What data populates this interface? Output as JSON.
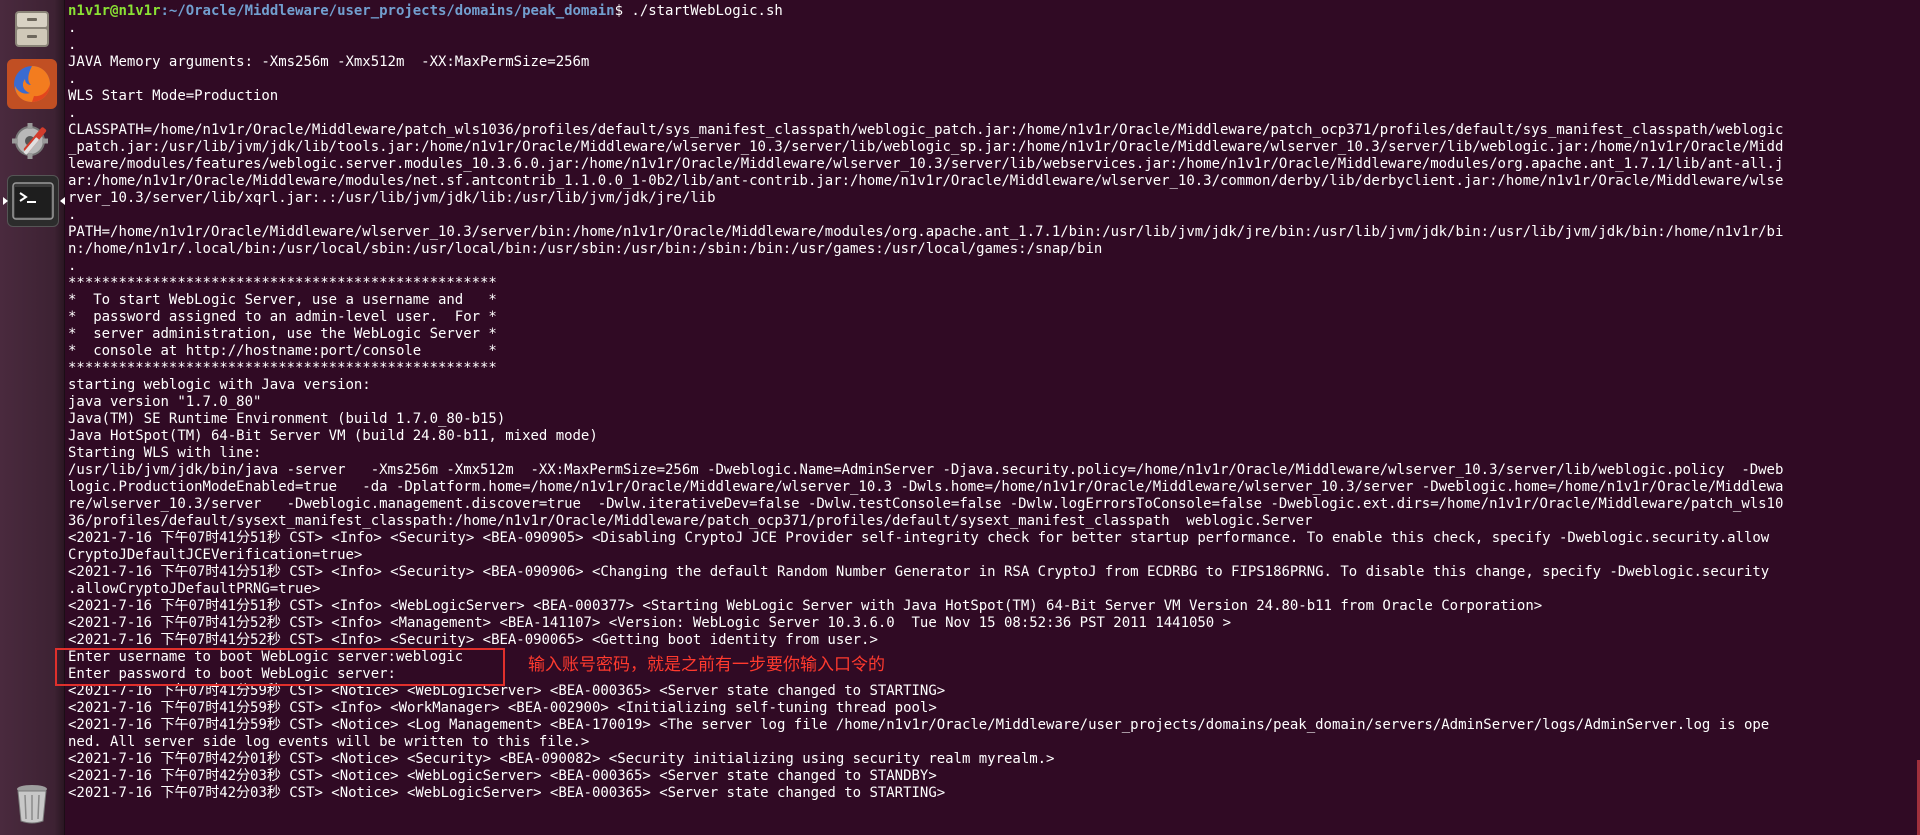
{
  "launcher": {
    "items": [
      {
        "name": "files-icon",
        "running": false
      },
      {
        "name": "firefox-icon",
        "running": false
      },
      {
        "name": "system-settings-icon",
        "running": false
      },
      {
        "name": "terminal-icon",
        "running": true
      },
      {
        "name": "trash-icon",
        "running": false
      }
    ]
  },
  "terminal": {
    "prompt": {
      "user_host": "n1v1r@n1v1r",
      "path": ":~/Oracle/Middleware/user_projects/domains/peak_domain",
      "symbol": "$ ",
      "command": "./startWebLogic.sh"
    },
    "lines": [
      ".",
      ".",
      "JAVA Memory arguments: -Xms256m -Xmx512m  -XX:MaxPermSize=256m",
      ".",
      "WLS Start Mode=Production",
      ".",
      "CLASSPATH=/home/n1v1r/Oracle/Middleware/patch_wls1036/profiles/default/sys_manifest_classpath/weblogic_patch.jar:/home/n1v1r/Oracle/Middleware/patch_ocp371/profiles/default/sys_manifest_classpath/weblogic",
      "_patch.jar:/usr/lib/jvm/jdk/lib/tools.jar:/home/n1v1r/Oracle/Middleware/wlserver_10.3/server/lib/weblogic_sp.jar:/home/n1v1r/Oracle/Middleware/wlserver_10.3/server/lib/weblogic.jar:/home/n1v1r/Oracle/Midd",
      "leware/modules/features/weblogic.server.modules_10.3.6.0.jar:/home/n1v1r/Oracle/Middleware/wlserver_10.3/server/lib/webservices.jar:/home/n1v1r/Oracle/Middleware/modules/org.apache.ant_1.7.1/lib/ant-all.j",
      "ar:/home/n1v1r/Oracle/Middleware/modules/net.sf.antcontrib_1.1.0.0_1-0b2/lib/ant-contrib.jar:/home/n1v1r/Oracle/Middleware/wlserver_10.3/common/derby/lib/derbyclient.jar:/home/n1v1r/Oracle/Middleware/wlse",
      "rver_10.3/server/lib/xqrl.jar:.:/usr/lib/jvm/jdk/lib:/usr/lib/jvm/jdk/jre/lib",
      ".",
      "PATH=/home/n1v1r/Oracle/Middleware/wlserver_10.3/server/bin:/home/n1v1r/Oracle/Middleware/modules/org.apache.ant_1.7.1/bin:/usr/lib/jvm/jdk/jre/bin:/usr/lib/jvm/jdk/bin:/usr/lib/jvm/jdk/bin:/home/n1v1r/bi",
      "n:/home/n1v1r/.local/bin:/usr/local/sbin:/usr/local/bin:/usr/sbin:/usr/bin:/sbin:/bin:/usr/games:/usr/local/games:/snap/bin",
      ".",
      "***************************************************",
      "*  To start WebLogic Server, use a username and   *",
      "*  password assigned to an admin-level user.  For *",
      "*  server administration, use the WebLogic Server *",
      "*  console at http://hostname:port/console        *",
      "***************************************************",
      "starting weblogic with Java version:",
      "java version \"1.7.0_80\"",
      "Java(TM) SE Runtime Environment (build 1.7.0_80-b15)",
      "Java HotSpot(TM) 64-Bit Server VM (build 24.80-b11, mixed mode)",
      "Starting WLS with line:",
      "/usr/lib/jvm/jdk/bin/java -server   -Xms256m -Xmx512m  -XX:MaxPermSize=256m -Dweblogic.Name=AdminServer -Djava.security.policy=/home/n1v1r/Oracle/Middleware/wlserver_10.3/server/lib/weblogic.policy  -Dweb",
      "logic.ProductionModeEnabled=true   -da -Dplatform.home=/home/n1v1r/Oracle/Middleware/wlserver_10.3 -Dwls.home=/home/n1v1r/Oracle/Middleware/wlserver_10.3/server -Dweblogic.home=/home/n1v1r/Oracle/Middlewa",
      "re/wlserver_10.3/server   -Dweblogic.management.discover=true  -Dwlw.iterativeDev=false -Dwlw.testConsole=false -Dwlw.logErrorsToConsole=false -Dweblogic.ext.dirs=/home/n1v1r/Oracle/Middleware/patch_wls10",
      "36/profiles/default/sysext_manifest_classpath:/home/n1v1r/Oracle/Middleware/patch_ocp371/profiles/default/sysext_manifest_classpath  weblogic.Server",
      "<2021-7-16 下午07时41分51秒 CST> <Info> <Security> <BEA-090905> <Disabling CryptoJ JCE Provider self-integrity check for better startup performance. To enable this check, specify -Dweblogic.security.allow",
      "CryptoJDefaultJCEVerification=true>",
      "<2021-7-16 下午07时41分51秒 CST> <Info> <Security> <BEA-090906> <Changing the default Random Number Generator in RSA CryptoJ from ECDRBG to FIPS186PRNG. To disable this change, specify -Dweblogic.security",
      ".allowCryptoJDefaultPRNG=true>",
      "<2021-7-16 下午07时41分51秒 CST> <Info> <WebLogicServer> <BEA-000377> <Starting WebLogic Server with Java HotSpot(TM) 64-Bit Server VM Version 24.80-b11 from Oracle Corporation>",
      "<2021-7-16 下午07时41分52秒 CST> <Info> <Management> <BEA-141107> <Version: WebLogic Server 10.3.6.0  Tue Nov 15 08:52:36 PST 2011 1441050 >",
      "<2021-7-16 下午07时41分52秒 CST> <Info> <Security> <BEA-090065> <Getting boot identity from user.>",
      "Enter username to boot WebLogic server:weblogic",
      "Enter password to boot WebLogic server:",
      "<2021-7-16 下午07时41分59秒 CST> <Notice> <WebLogicServer> <BEA-000365> <Server state changed to STARTING>",
      "<2021-7-16 下午07时41分59秒 CST> <Info> <WorkManager> <BEA-002900> <Initializing self-tuning thread pool>",
      "<2021-7-16 下午07时41分59秒 CST> <Notice> <Log Management> <BEA-170019> <The server log file /home/n1v1r/Oracle/Middleware/user_projects/domains/peak_domain/servers/AdminServer/logs/AdminServer.log is ope",
      "ned. All server side log events will be written to this file.>",
      "<2021-7-16 下午07时42分01秒 CST> <Notice> <Security> <BEA-090082> <Security initializing using security realm myrealm.>",
      "<2021-7-16 下午07时42分03秒 CST> <Notice> <WebLogicServer> <BEA-000365> <Server state changed to STANDBY>",
      "<2021-7-16 下午07时42分03秒 CST> <Notice> <WebLogicServer> <BEA-000365> <Server state changed to STARTING>"
    ]
  },
  "annotation": {
    "text": "输入账号密码，就是之前有一步要你输入口令的",
    "color": "#ff3a2e"
  },
  "colors": {
    "terminal_bg": "#300a24",
    "prompt_user": "#8ae234",
    "prompt_path": "#729fcf",
    "highlight_border": "#e0302c"
  }
}
